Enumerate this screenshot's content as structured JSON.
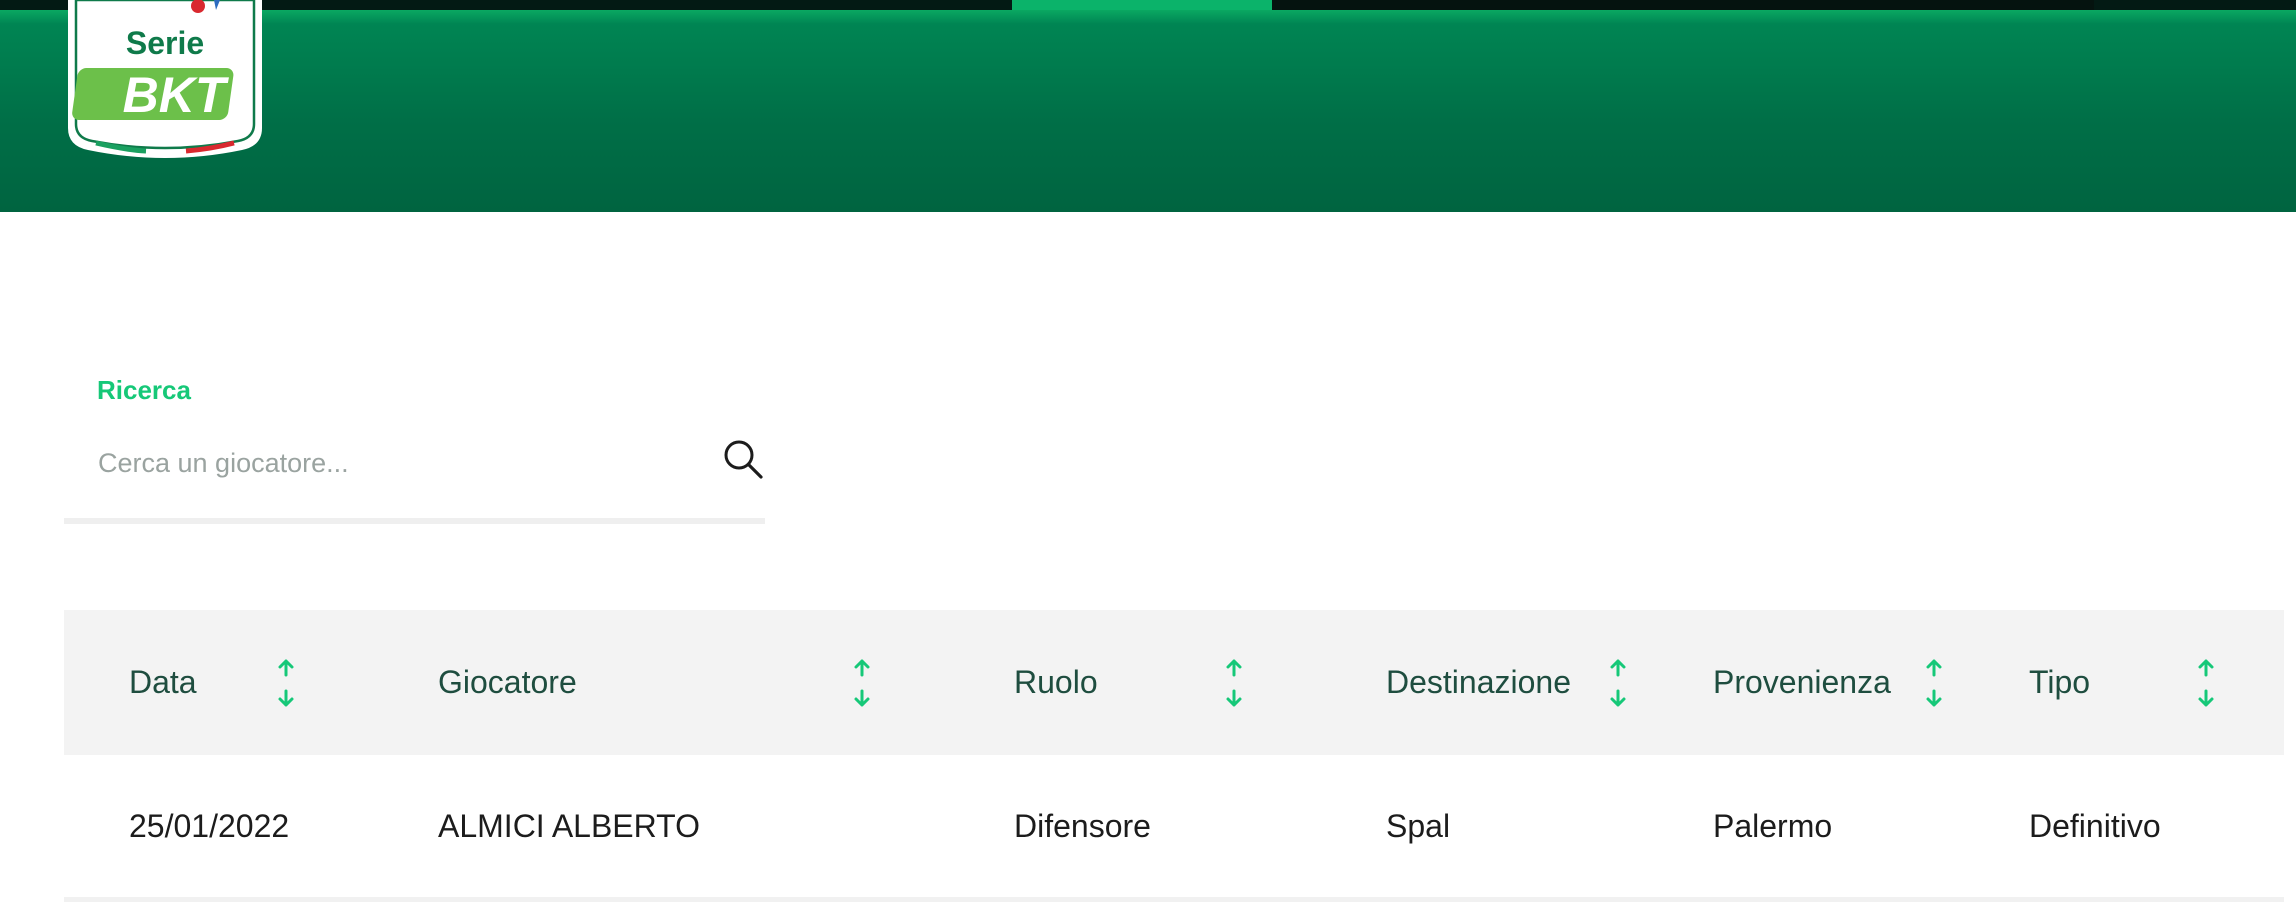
{
  "brand": {
    "line1": "Serie",
    "line2": "BKT",
    "colors": {
      "header_green": "#007a4d",
      "accent_green": "#16c878",
      "bkt_green": "#6cc04a"
    }
  },
  "search": {
    "label": "Ricerca",
    "placeholder": "Cerca un giocatore...",
    "value": "",
    "icon": "search-icon"
  },
  "table": {
    "columns": [
      {
        "key": "data",
        "label": "Data"
      },
      {
        "key": "giocatore",
        "label": "Giocatore"
      },
      {
        "key": "ruolo",
        "label": "Ruolo"
      },
      {
        "key": "destinazione",
        "label": "Destinazione"
      },
      {
        "key": "provenienza",
        "label": "Provenienza"
      },
      {
        "key": "tipo",
        "label": "Tipo"
      }
    ],
    "sort_icon": "sort-arrows-icon",
    "rows": [
      {
        "data": "25/01/2022",
        "giocatore": "ALMICI ALBERTO",
        "ruolo": "Difensore",
        "destinazione": "Spal",
        "provenienza": "Palermo",
        "tipo": "Definitivo"
      }
    ]
  }
}
